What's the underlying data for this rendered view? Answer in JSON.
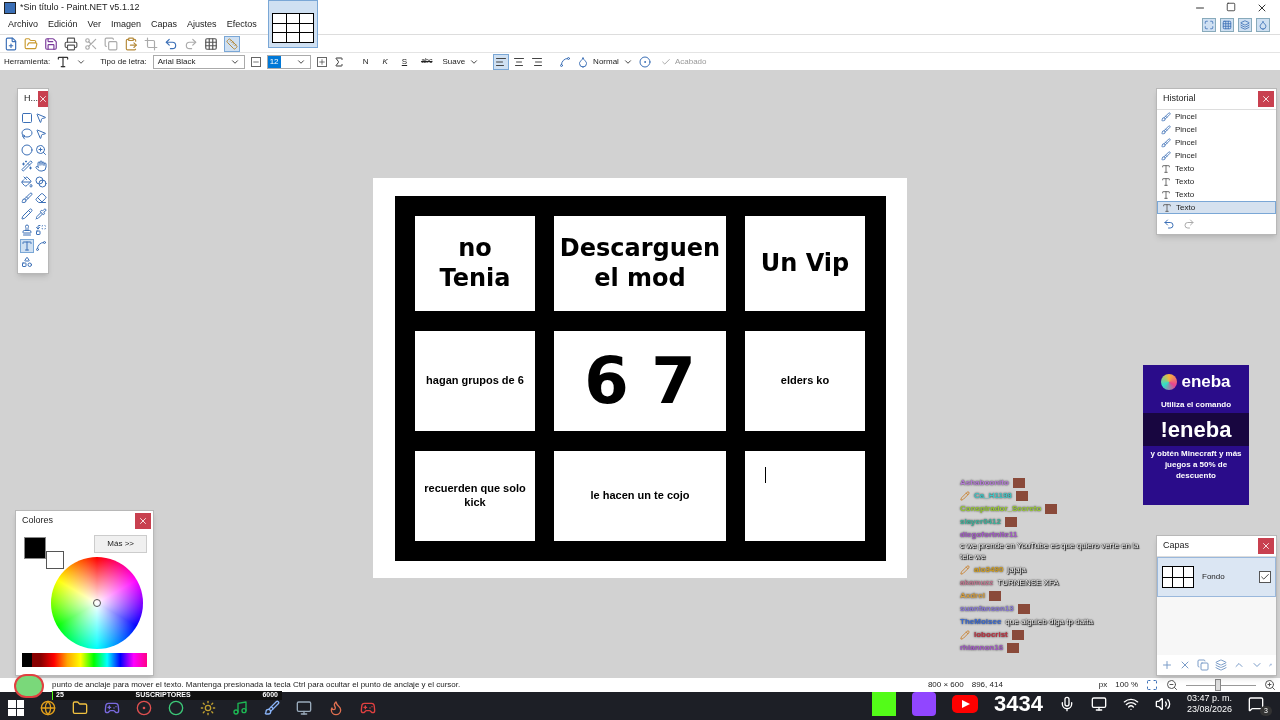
{
  "window": {
    "title": "*Sin título - Paint.NET v5.1.12"
  },
  "menu": [
    "Archivo",
    "Edición",
    "Ver",
    "Imagen",
    "Capas",
    "Ajustes",
    "Efectos"
  ],
  "options": {
    "tool_label": "Herramienta:",
    "font_label": "Tipo de letra:",
    "font": "Arial Black",
    "size": "12",
    "bold": "N",
    "italic": "K",
    "underline": "S",
    "strike": "abc",
    "antialias": "Suave",
    "blend": "Normal",
    "finish": "Acabado"
  },
  "alignment": [
    {
      "kind": "left",
      "selected": true
    },
    {
      "kind": "center",
      "selected": false
    },
    {
      "kind": "right",
      "selected": false
    }
  ],
  "tools_panel": {
    "title": "H...",
    "tools": [
      {
        "kind": "rect-select",
        "selected": false
      },
      {
        "kind": "move",
        "selected": false
      },
      {
        "kind": "lasso",
        "selected": false
      },
      {
        "kind": "move-outline",
        "selected": false
      },
      {
        "kind": "ellipse",
        "selected": false
      },
      {
        "kind": "zoom",
        "selected": false
      },
      {
        "kind": "wand",
        "selected": false
      },
      {
        "kind": "pan",
        "selected": false
      },
      {
        "kind": "bucket",
        "selected": false
      },
      {
        "kind": "gradient",
        "selected": false
      },
      {
        "kind": "brush",
        "selected": false
      },
      {
        "kind": "eraser",
        "selected": false
      },
      {
        "kind": "pencil",
        "selected": false
      },
      {
        "kind": "picker",
        "selected": false
      },
      {
        "kind": "stamp",
        "selected": false
      },
      {
        "kind": "recolor",
        "selected": false
      },
      {
        "kind": "text",
        "selected": true
      },
      {
        "kind": "line",
        "selected": false
      },
      {
        "kind": "shapes",
        "selected": false
      }
    ]
  },
  "history": {
    "title": "Historial",
    "items": [
      {
        "kind": "brush",
        "label": "Pincel",
        "selected": false
      },
      {
        "kind": "brush",
        "label": "Pincel",
        "selected": false
      },
      {
        "kind": "brush",
        "label": "Pincel",
        "selected": false
      },
      {
        "kind": "brush",
        "label": "Pincel",
        "selected": false
      },
      {
        "kind": "text",
        "label": "Texto",
        "selected": false
      },
      {
        "kind": "text",
        "label": "Texto",
        "selected": false
      },
      {
        "kind": "text",
        "label": "Texto",
        "selected": false
      },
      {
        "kind": "text",
        "label": "Texto",
        "selected": true
      }
    ]
  },
  "comic": [
    {
      "kind": "handwritten",
      "text": "no Tenia"
    },
    {
      "kind": "handwritten",
      "text": "Descarguen el mod"
    },
    {
      "kind": "handwritten",
      "text": "Un Vip"
    },
    {
      "kind": "typed",
      "text": "hagan grupos de 6"
    },
    {
      "kind": "handwritten",
      "text": "6 7"
    },
    {
      "kind": "typed",
      "text": "elders ko"
    },
    {
      "kind": "typed",
      "text": "recuerden que solo kick"
    },
    {
      "kind": "typed",
      "text": "le hacen un te cojo"
    },
    {
      "kind": "cursor"
    }
  ],
  "colors_panel": {
    "title": "Colores",
    "more": "Más >>"
  },
  "layers_panel": {
    "title": "Capas",
    "layers": [
      {
        "name": "Fondo",
        "visible": true,
        "selected": true
      }
    ]
  },
  "ad": {
    "brand": "eneba",
    "line_1": "Utiliza el comando",
    "command": "!eneba",
    "line_2": "y obtén Minecraft y más juegos a 50% de descuento"
  },
  "chat": [
    {
      "kind": "emote",
      "name": "Ashaboonito",
      "color": "#b57bd6",
      "badge": false
    },
    {
      "kind": "emote",
      "name": "Ca_H1198",
      "color": "#3fc8c8",
      "badge": true
    },
    {
      "kind": "emote",
      "name": "Conspirador_Secreto",
      "color": "#9acd32",
      "badge": false
    },
    {
      "kind": "emote",
      "name": "slayer0412",
      "color": "#3cb39b",
      "badge": false
    },
    {
      "kind": "message",
      "name": "diegofortnite11",
      "color": "#a45ac8",
      "badge": false,
      "message": "c we prende en YouTube es que quiero verte en la tele we"
    },
    {
      "kind": "message",
      "name": "alo3490",
      "color": "#d4a020",
      "badge": true,
      "message": "jajaja"
    },
    {
      "kind": "message",
      "name": "akamuzz",
      "color": "#c07890",
      "badge": false,
      "message": "TURNENSE XFA"
    },
    {
      "kind": "emote",
      "name": "Axdrel",
      "color": "#d8a040",
      "badge": false
    },
    {
      "kind": "emote",
      "name": "suanfanson13",
      "color": "#8a7ad8",
      "badge": false
    },
    {
      "kind": "message",
      "name": "TheMoisee",
      "color": "#3a6ad0",
      "badge": false,
      "message": "que alguieb diga tp datta"
    },
    {
      "kind": "emote",
      "name": "lobocrist",
      "color": "#c03040",
      "badge": true
    },
    {
      "kind": "emote",
      "name": "rhiannon16",
      "color": "#a45ac8",
      "badge": false
    }
  ],
  "status_bar": {
    "hint": "punto de anclaje para mover el texto. Mantenga presionada la tecla Ctrl para ocultar el punto de anclaje y el cursor.",
    "image_size": "800 × 600",
    "cursor": "896, 414",
    "unit": "px",
    "zoom": "100 %"
  },
  "zoom_slider": {
    "level": 0.45
  },
  "sub_goal": {
    "current": "25",
    "label": "SUSCRIPTORES",
    "goal": "6000",
    "level": 0.004
  },
  "taskbar": {
    "viewers": "3434",
    "time": "03:47 p. m.",
    "date": "23/08/2026",
    "notifications": "3"
  }
}
